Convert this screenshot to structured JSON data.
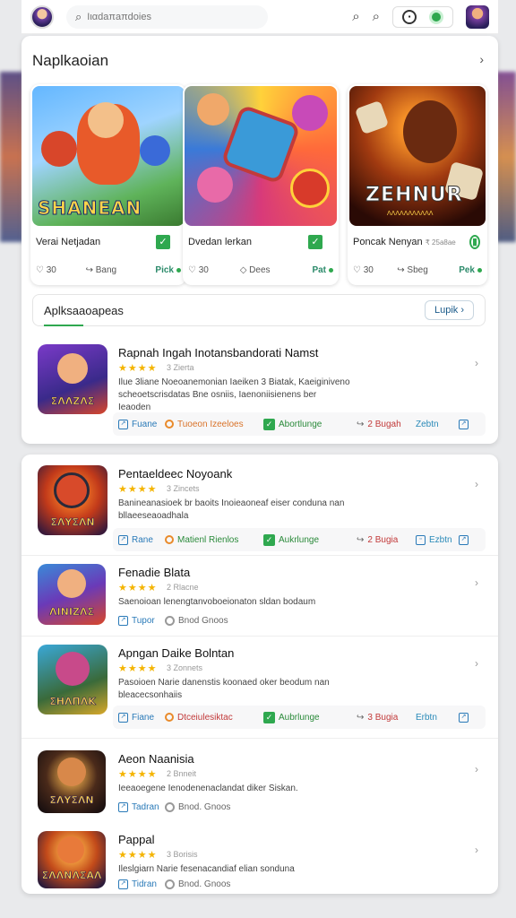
{
  "header": {
    "search_placeholder": "Ιιαdaπaπdoies",
    "colors": {
      "accent": "#2fa84f",
      "link": "#2a7ab8"
    }
  },
  "featured": {
    "title": "Naplkaoian",
    "more": "›",
    "items": [
      {
        "art_title": "SHANEAN",
        "name": "Verai Netjadan",
        "likes": "30",
        "shares": "Bang",
        "tag": "Pick"
      },
      {
        "art_title": "",
        "name": "Dvedan lerkan",
        "likes": "30",
        "shares": "Dees",
        "tag": "Pat"
      },
      {
        "art_title": "ZEHNUR",
        "art_sub": "ΛΛΛΛΛΛΛΛΛΛΛ",
        "name": "Poncak Nenyan",
        "price": "₹ 25a8ae",
        "likes": "30",
        "shares": "Sbeg",
        "tag": "Pek"
      }
    ]
  },
  "apps_section": {
    "title": "Aplksaaoapeas",
    "button": "Lupik"
  },
  "apps": [
    {
      "icon_text": "ΣΛΛΖΛΣ",
      "name": "Rapnah Ingah Inotansbandorati Namst",
      "stars": "★★★★",
      "reviews": "3 Zierta",
      "desc": "Ilue 3liane Noeoanemonian Iaeiken 3 Biatak, Kaeiginiveno scheoetscrisdatas Bne osniis, Iaenoniisienens ber Ieaoden",
      "actions": [
        "Fuane",
        "Tuoeon Izeeloes",
        "Abortlunge",
        "2 Bugah",
        "Zebtn"
      ]
    },
    {
      "icon_text": "ΣΛΥΣΛΝ",
      "name": "Pentaeldeec Noyoank",
      "stars": "★★★★",
      "reviews": "3 Zincets",
      "desc": "Banineanasioek br baoits Inoieaoneaf eiser conduna nan bllaeeseaoadhala",
      "actions": [
        "Rane",
        "Matienl Rienlos",
        "Aukrlunge",
        "2 Bugia",
        "Ezbtn"
      ]
    },
    {
      "icon_text": "ΛΙΝΙΖΛΣ",
      "name": "Fenadie Blata",
      "stars": "★★★★",
      "reviews": "2 Rlacne",
      "desc": "Saenoioan lenengtanvoboeionaton sldan bodaum",
      "actions": [
        "Tupor",
        "Bnod Gnoos"
      ]
    },
    {
      "icon_text": "ΣΗΛΠΛΚ",
      "name": "Apngan Daike Bolntan",
      "stars": "★★★★",
      "reviews": "3 Zonnets",
      "desc": "Pasoioen Narie danenstis koonaed oker beodum nan bleacecsonhaiis",
      "actions": [
        "Fiane",
        "Dtceiulesiktac",
        "Aubrlunge",
        "3 Bugia",
        "Erbtn"
      ]
    },
    {
      "icon_text": "ΣΛΥΣΛΝ",
      "name": "Aeon Naanisia",
      "stars": "★★★★",
      "reviews": "2 Bnneit",
      "desc": "Ieeaoegene Ienodenenaclandat diker Siskan.",
      "actions": [
        "Tadran",
        "Bnod. Gnoos"
      ]
    },
    {
      "icon_text": "ΣΛΛΝΛΣΑΛ",
      "name": "Pappal",
      "stars": "★★★★",
      "reviews": "3 Borisis",
      "desc": "Ileslgiarn Narie fesenacandiaf elian sonduna",
      "actions": [
        "Tidran",
        "Bnod. Gnoos"
      ]
    }
  ]
}
